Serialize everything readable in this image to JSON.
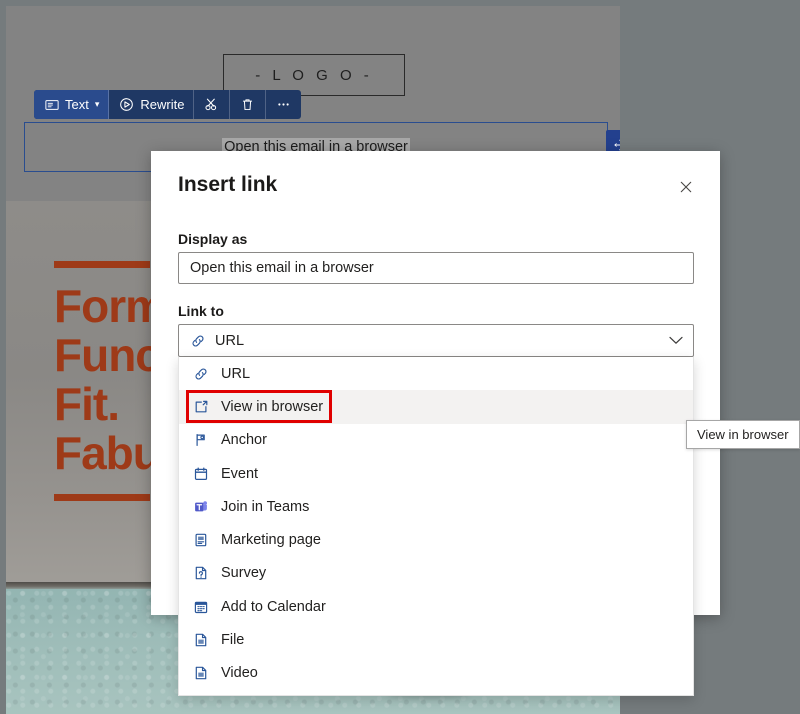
{
  "colors": {
    "toolbar_bg": "#1f3864",
    "accent_blue": "#23408e",
    "hero_rust": "#9e3a18",
    "annotation_red": "#e00000",
    "icon_blue": "#2b579a"
  },
  "canvas": {
    "logo_placeholder": "-  L O G O  -",
    "link_block_text": "Open this email in a browser",
    "hero_headline": "Form.\nFunction.\nFit.\nFabulous.",
    "toolbar": {
      "items": [
        {
          "label": "Text",
          "icon": "text-block-icon",
          "has_chevron": true,
          "active": true
        },
        {
          "label": "Rewrite",
          "icon": "rewrite-icon",
          "has_chevron": false,
          "active": false
        },
        {
          "label": "",
          "icon": "cut-icon",
          "has_chevron": false,
          "active": false
        },
        {
          "label": "",
          "icon": "trash-icon",
          "has_chevron": false,
          "active": false
        },
        {
          "label": "",
          "icon": "more-options-icon",
          "has_chevron": false,
          "active": false
        }
      ]
    },
    "move_handle_icon": "move-handle-icon"
  },
  "dialog": {
    "title": "Insert link",
    "close_icon": "close-icon",
    "display_as": {
      "label": "Display as",
      "value": "Open this email in a browser",
      "placeholder": "Display as"
    },
    "link_to": {
      "label": "Link to",
      "selected": "URL",
      "selected_icon": "url-link-icon",
      "chevron_icon": "chevron-down-icon",
      "options": [
        {
          "label": "URL",
          "icon": "url-link-icon",
          "hover": false
        },
        {
          "label": "View in browser",
          "icon": "view-in-browser-icon",
          "hover": true
        },
        {
          "label": "Anchor",
          "icon": "anchor-flag-icon",
          "hover": false
        },
        {
          "label": "Event",
          "icon": "event-calendar-icon",
          "hover": false
        },
        {
          "label": "Join in Teams",
          "icon": "teams-icon",
          "hover": false
        },
        {
          "label": "Marketing page",
          "icon": "marketing-page-icon",
          "hover": false
        },
        {
          "label": "Survey",
          "icon": "survey-icon",
          "hover": false
        },
        {
          "label": "Add to Calendar",
          "icon": "add-to-calendar-icon",
          "hover": false
        },
        {
          "label": "File",
          "icon": "file-icon",
          "hover": false
        },
        {
          "label": "Video",
          "icon": "video-file-icon",
          "hover": false
        }
      ]
    }
  },
  "tooltip": {
    "text": "View in browser"
  },
  "annotation": {
    "target": "View in browser"
  }
}
